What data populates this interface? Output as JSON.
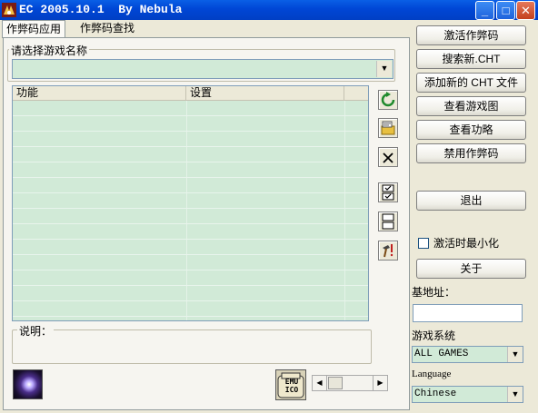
{
  "window": {
    "title": "EC 2005.10.1  By Nebula",
    "min_glyph": "_",
    "max_glyph": "□",
    "close_glyph": "✕"
  },
  "tabs": [
    {
      "label": "作弊码应用",
      "active": true
    },
    {
      "label": "作弊码查找",
      "active": false
    }
  ],
  "game_select": {
    "label": "请选择游戏名称",
    "value": "",
    "arrow": "▼"
  },
  "cheat_list": {
    "columns": [
      "功能",
      "设置"
    ],
    "rows": []
  },
  "description": {
    "label": "说明："
  },
  "toolbar_icons": [
    "refresh-icon",
    "open-cht-icon",
    "delete-icon",
    "check-all-icon",
    "uncheck-all-icon",
    "edit-tool-icon"
  ],
  "logo_text": "EMU\nICO",
  "scroll": {
    "left": "◀",
    "right": "▶"
  },
  "right_panel": {
    "buttons": [
      "激活作弊码",
      "搜索新.CHT",
      "添加新的 CHT 文件",
      "查看游戏图",
      "查看功略",
      "禁用作弊码"
    ],
    "exit_label": "退出",
    "minimize_on_activate_label": "激活时最小化",
    "minimize_on_activate_checked": false,
    "about_label": "关于",
    "base_address_label": "基地址：",
    "base_address_value": "",
    "game_system_label": "游戏系统",
    "game_system_value": "ALL GAMES",
    "language_label": "Language",
    "language_value": "Chinese"
  },
  "colors": {
    "list_bg": "#d1ead7",
    "titlebar": "#0046d5",
    "face": "#ece9d8"
  }
}
